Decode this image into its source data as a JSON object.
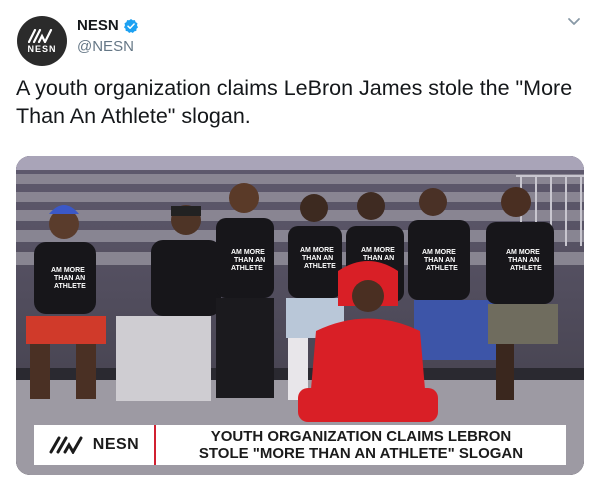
{
  "author": {
    "display_name": "NESN",
    "handle": "@NESN",
    "avatar_text": "NESN",
    "verified": true
  },
  "tweet": {
    "text": "A youth organization claims LeBron James stole the \"More Than An Athlete\" slogan."
  },
  "media": {
    "lower_third": {
      "network": "NESN",
      "headline_line1": "YOUTH ORGANIZATION CLAIMS LEBRON",
      "headline_line2": "STOLE \"MORE THAN AN ATHLETE\" SLOGAN"
    },
    "shirt_text": "I AM MORE THAN AN ATHLETE"
  },
  "icons": {
    "verified": "verified-badge-icon",
    "more": "chevron-down-icon"
  },
  "colors": {
    "verified_blue": "#1da1f2",
    "handle_gray": "#657786",
    "text": "#14171a",
    "caret": "#8899a6"
  }
}
